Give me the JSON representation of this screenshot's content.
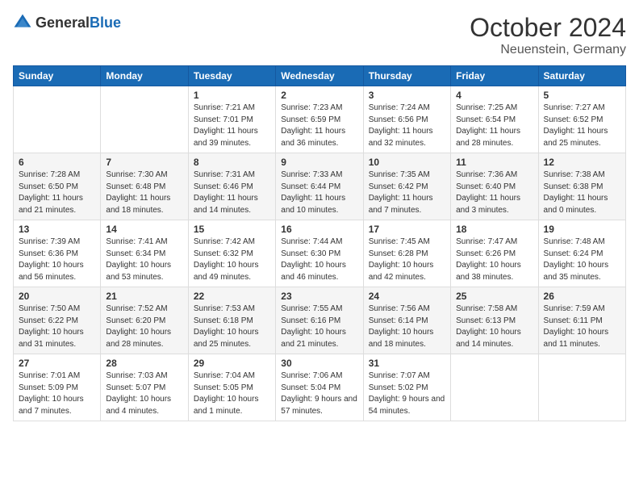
{
  "header": {
    "logo_general": "General",
    "logo_blue": "Blue",
    "month_title": "October 2024",
    "location": "Neuenstein, Germany"
  },
  "weekdays": [
    "Sunday",
    "Monday",
    "Tuesday",
    "Wednesday",
    "Thursday",
    "Friday",
    "Saturday"
  ],
  "weeks": [
    [
      {
        "day": "",
        "info": ""
      },
      {
        "day": "",
        "info": ""
      },
      {
        "day": "1",
        "info": "Sunrise: 7:21 AM\nSunset: 7:01 PM\nDaylight: 11 hours and 39 minutes."
      },
      {
        "day": "2",
        "info": "Sunrise: 7:23 AM\nSunset: 6:59 PM\nDaylight: 11 hours and 36 minutes."
      },
      {
        "day": "3",
        "info": "Sunrise: 7:24 AM\nSunset: 6:56 PM\nDaylight: 11 hours and 32 minutes."
      },
      {
        "day": "4",
        "info": "Sunrise: 7:25 AM\nSunset: 6:54 PM\nDaylight: 11 hours and 28 minutes."
      },
      {
        "day": "5",
        "info": "Sunrise: 7:27 AM\nSunset: 6:52 PM\nDaylight: 11 hours and 25 minutes."
      }
    ],
    [
      {
        "day": "6",
        "info": "Sunrise: 7:28 AM\nSunset: 6:50 PM\nDaylight: 11 hours and 21 minutes."
      },
      {
        "day": "7",
        "info": "Sunrise: 7:30 AM\nSunset: 6:48 PM\nDaylight: 11 hours and 18 minutes."
      },
      {
        "day": "8",
        "info": "Sunrise: 7:31 AM\nSunset: 6:46 PM\nDaylight: 11 hours and 14 minutes."
      },
      {
        "day": "9",
        "info": "Sunrise: 7:33 AM\nSunset: 6:44 PM\nDaylight: 11 hours and 10 minutes."
      },
      {
        "day": "10",
        "info": "Sunrise: 7:35 AM\nSunset: 6:42 PM\nDaylight: 11 hours and 7 minutes."
      },
      {
        "day": "11",
        "info": "Sunrise: 7:36 AM\nSunset: 6:40 PM\nDaylight: 11 hours and 3 minutes."
      },
      {
        "day": "12",
        "info": "Sunrise: 7:38 AM\nSunset: 6:38 PM\nDaylight: 11 hours and 0 minutes."
      }
    ],
    [
      {
        "day": "13",
        "info": "Sunrise: 7:39 AM\nSunset: 6:36 PM\nDaylight: 10 hours and 56 minutes."
      },
      {
        "day": "14",
        "info": "Sunrise: 7:41 AM\nSunset: 6:34 PM\nDaylight: 10 hours and 53 minutes."
      },
      {
        "day": "15",
        "info": "Sunrise: 7:42 AM\nSunset: 6:32 PM\nDaylight: 10 hours and 49 minutes."
      },
      {
        "day": "16",
        "info": "Sunrise: 7:44 AM\nSunset: 6:30 PM\nDaylight: 10 hours and 46 minutes."
      },
      {
        "day": "17",
        "info": "Sunrise: 7:45 AM\nSunset: 6:28 PM\nDaylight: 10 hours and 42 minutes."
      },
      {
        "day": "18",
        "info": "Sunrise: 7:47 AM\nSunset: 6:26 PM\nDaylight: 10 hours and 38 minutes."
      },
      {
        "day": "19",
        "info": "Sunrise: 7:48 AM\nSunset: 6:24 PM\nDaylight: 10 hours and 35 minutes."
      }
    ],
    [
      {
        "day": "20",
        "info": "Sunrise: 7:50 AM\nSunset: 6:22 PM\nDaylight: 10 hours and 31 minutes."
      },
      {
        "day": "21",
        "info": "Sunrise: 7:52 AM\nSunset: 6:20 PM\nDaylight: 10 hours and 28 minutes."
      },
      {
        "day": "22",
        "info": "Sunrise: 7:53 AM\nSunset: 6:18 PM\nDaylight: 10 hours and 25 minutes."
      },
      {
        "day": "23",
        "info": "Sunrise: 7:55 AM\nSunset: 6:16 PM\nDaylight: 10 hours and 21 minutes."
      },
      {
        "day": "24",
        "info": "Sunrise: 7:56 AM\nSunset: 6:14 PM\nDaylight: 10 hours and 18 minutes."
      },
      {
        "day": "25",
        "info": "Sunrise: 7:58 AM\nSunset: 6:13 PM\nDaylight: 10 hours and 14 minutes."
      },
      {
        "day": "26",
        "info": "Sunrise: 7:59 AM\nSunset: 6:11 PM\nDaylight: 10 hours and 11 minutes."
      }
    ],
    [
      {
        "day": "27",
        "info": "Sunrise: 7:01 AM\nSunset: 5:09 PM\nDaylight: 10 hours and 7 minutes."
      },
      {
        "day": "28",
        "info": "Sunrise: 7:03 AM\nSunset: 5:07 PM\nDaylight: 10 hours and 4 minutes."
      },
      {
        "day": "29",
        "info": "Sunrise: 7:04 AM\nSunset: 5:05 PM\nDaylight: 10 hours and 1 minute."
      },
      {
        "day": "30",
        "info": "Sunrise: 7:06 AM\nSunset: 5:04 PM\nDaylight: 9 hours and 57 minutes."
      },
      {
        "day": "31",
        "info": "Sunrise: 7:07 AM\nSunset: 5:02 PM\nDaylight: 9 hours and 54 minutes."
      },
      {
        "day": "",
        "info": ""
      },
      {
        "day": "",
        "info": ""
      }
    ]
  ]
}
